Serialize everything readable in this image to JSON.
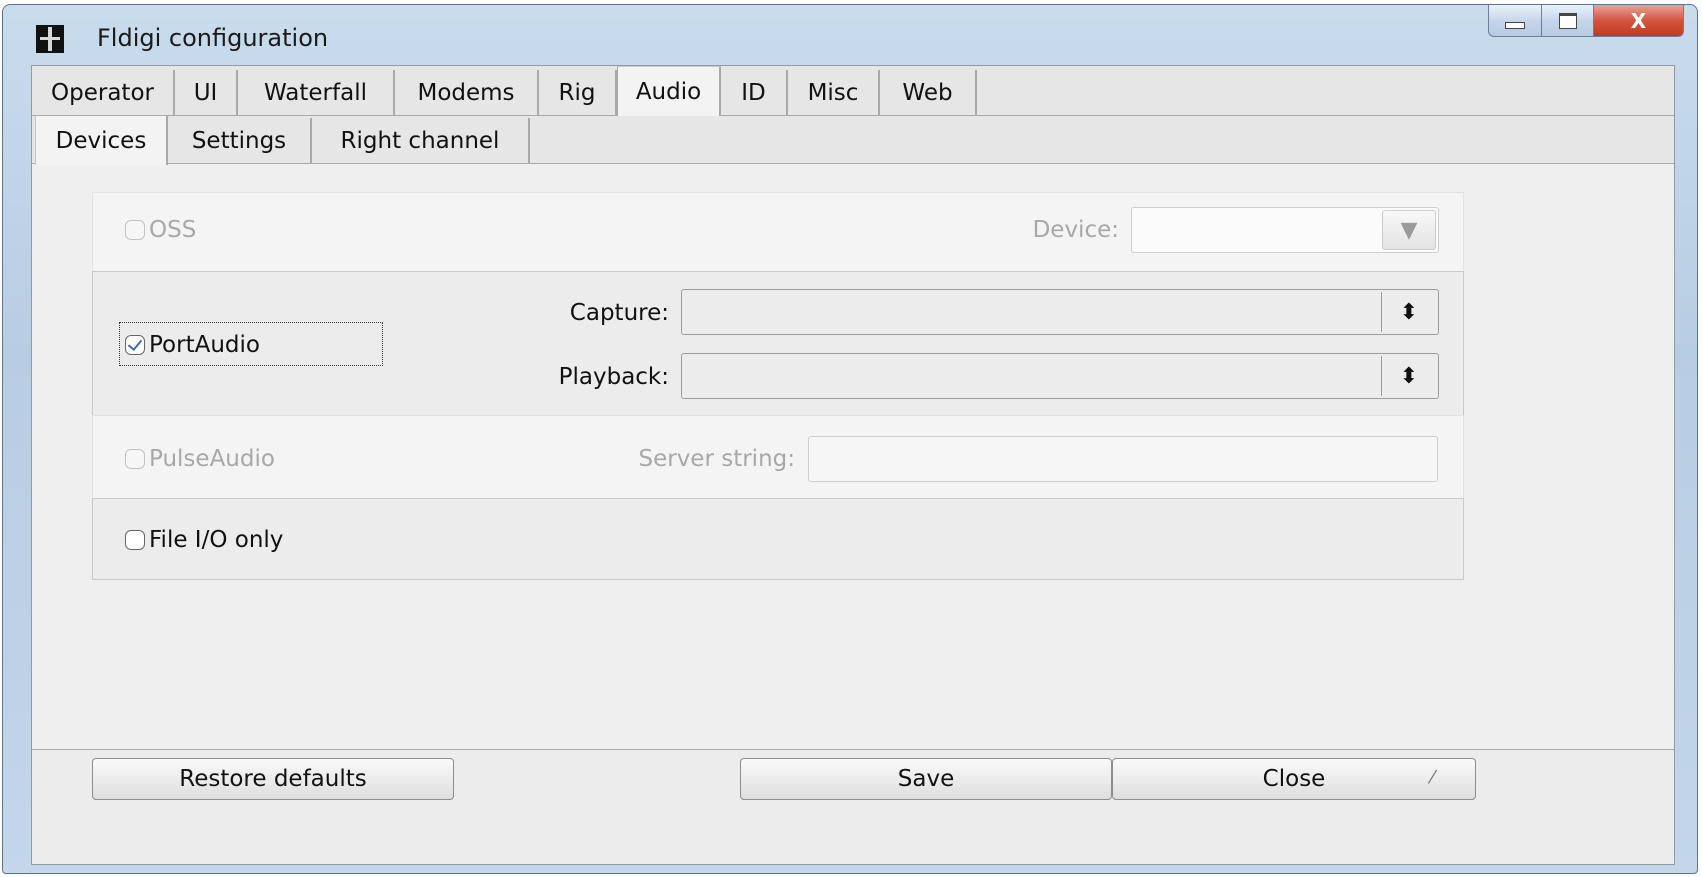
{
  "window": {
    "title": "Fldigi configuration"
  },
  "tabs": [
    "Operator",
    "UI",
    "Waterfall",
    "Modems",
    "Rig",
    "Audio",
    "ID",
    "Misc",
    "Web"
  ],
  "active_tab": "Audio",
  "subtabs": [
    "Devices",
    "Settings",
    "Right channel"
  ],
  "active_subtab": "Devices",
  "devices": {
    "oss": {
      "label": "OSS",
      "checked": false,
      "enabled": false,
      "device_label": "Device:",
      "device_value": ""
    },
    "portaudio": {
      "label": "PortAudio",
      "checked": true,
      "capture_label": "Capture:",
      "capture_value": "",
      "playback_label": "Playback:",
      "playback_value": ""
    },
    "pulseaudio": {
      "label": "PulseAudio",
      "checked": false,
      "enabled": false,
      "server_label": "Server string:",
      "server_value": ""
    },
    "fileio": {
      "label": "File I/O only",
      "checked": false
    }
  },
  "buttons": {
    "restore": "Restore defaults",
    "save": "Save",
    "close": "Close"
  },
  "icons": {
    "window_min": "minimize-icon",
    "window_max": "maximize-icon",
    "window_close": "close-icon",
    "combo_dropdown": "dropdown-arrow-icon",
    "spinner": "spinner-arrows-icon"
  },
  "glyphs": {
    "close_x": "X",
    "dropdown": "▼",
    "spinner": "⬍",
    "grip": "⁄"
  }
}
